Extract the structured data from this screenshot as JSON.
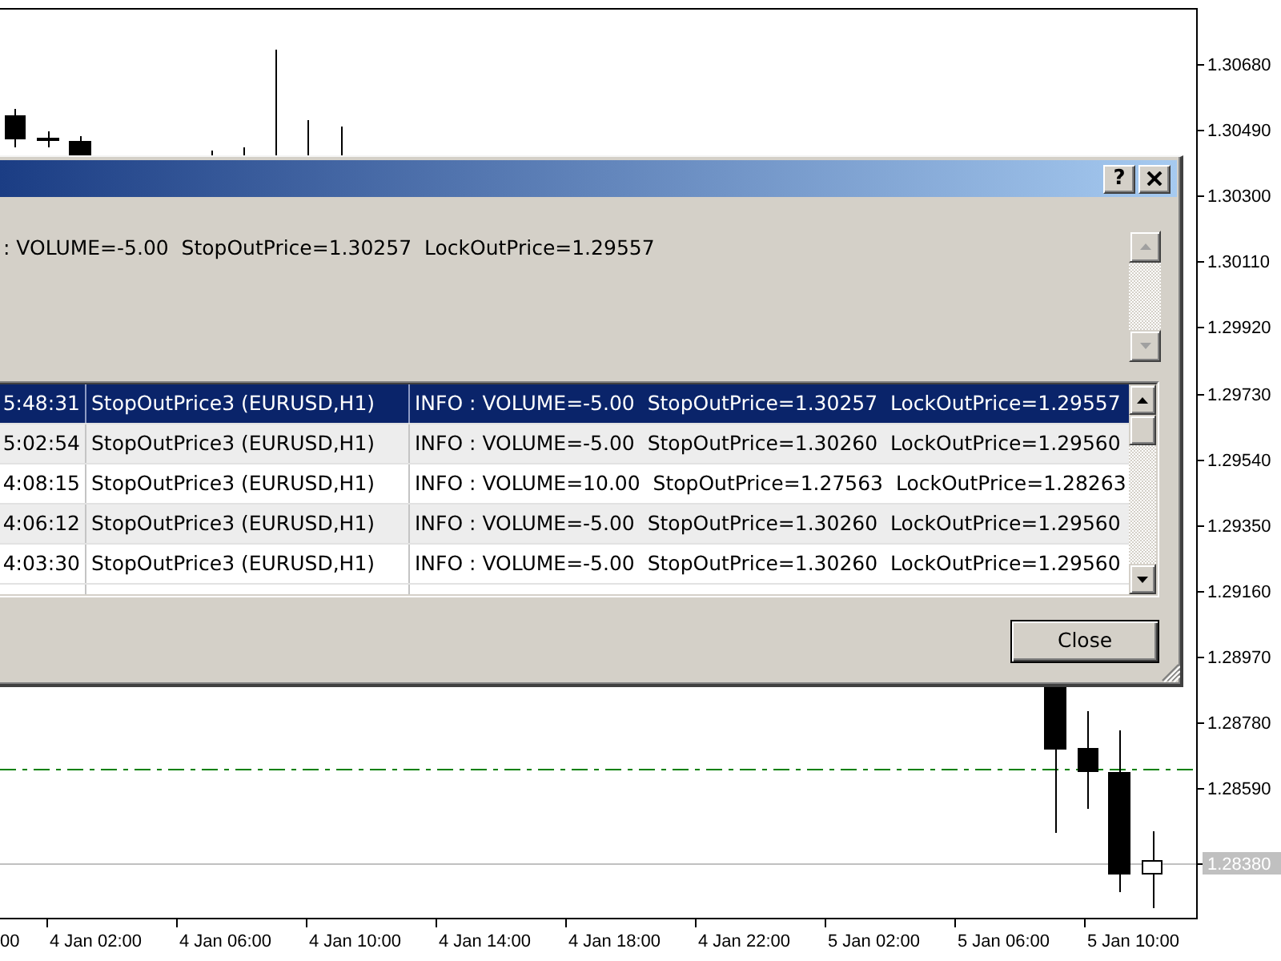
{
  "chart": {
    "price_labels": [
      "1.30680",
      "1.30490",
      "1.30300",
      "1.30110",
      "1.29920",
      "1.29730",
      "1.29540",
      "1.29350",
      "1.29160",
      "1.28970",
      "1.28780",
      "1.28590"
    ],
    "current_price": "1.28380",
    "time_labels": [
      "00",
      "4 Jan 02:00",
      "4 Jan 06:00",
      "4 Jan 10:00",
      "4 Jan 14:00",
      "4 Jan 18:00",
      "4 Jan 22:00",
      "5 Jan 02:00",
      "5 Jan 06:00",
      "5 Jan 10:00"
    ]
  },
  "dialog": {
    "help_button": "?",
    "message": ": VOLUME=-5.00  StopOutPrice=1.30257  LockOutPrice=1.29557",
    "message_scrollbar_disabled": true,
    "log_rows": [
      {
        "time": "5:48:31",
        "source": "StopOutPrice3 (EURUSD,H1)",
        "message": "INFO : VOLUME=-5.00  StopOutPrice=1.30257  LockOutPrice=1.29557",
        "selected": true
      },
      {
        "time": "5:02:54",
        "source": "StopOutPrice3 (EURUSD,H1)",
        "message": "INFO : VOLUME=-5.00  StopOutPrice=1.30260  LockOutPrice=1.29560",
        "selected": false
      },
      {
        "time": "4:08:15",
        "source": "StopOutPrice3 (EURUSD,H1)",
        "message": "INFO : VOLUME=10.00  StopOutPrice=1.27563  LockOutPrice=1.28263",
        "selected": false
      },
      {
        "time": "4:06:12",
        "source": "StopOutPrice3 (EURUSD,H1)",
        "message": "INFO : VOLUME=-5.00  StopOutPrice=1.30260  LockOutPrice=1.29560",
        "selected": false
      },
      {
        "time": "4:03:30",
        "source": "StopOutPrice3 (EURUSD,H1)",
        "message": "INFO : VOLUME=-5.00  StopOutPrice=1.30260  LockOutPrice=1.29560",
        "selected": false
      }
    ],
    "close_button": "Close"
  }
}
